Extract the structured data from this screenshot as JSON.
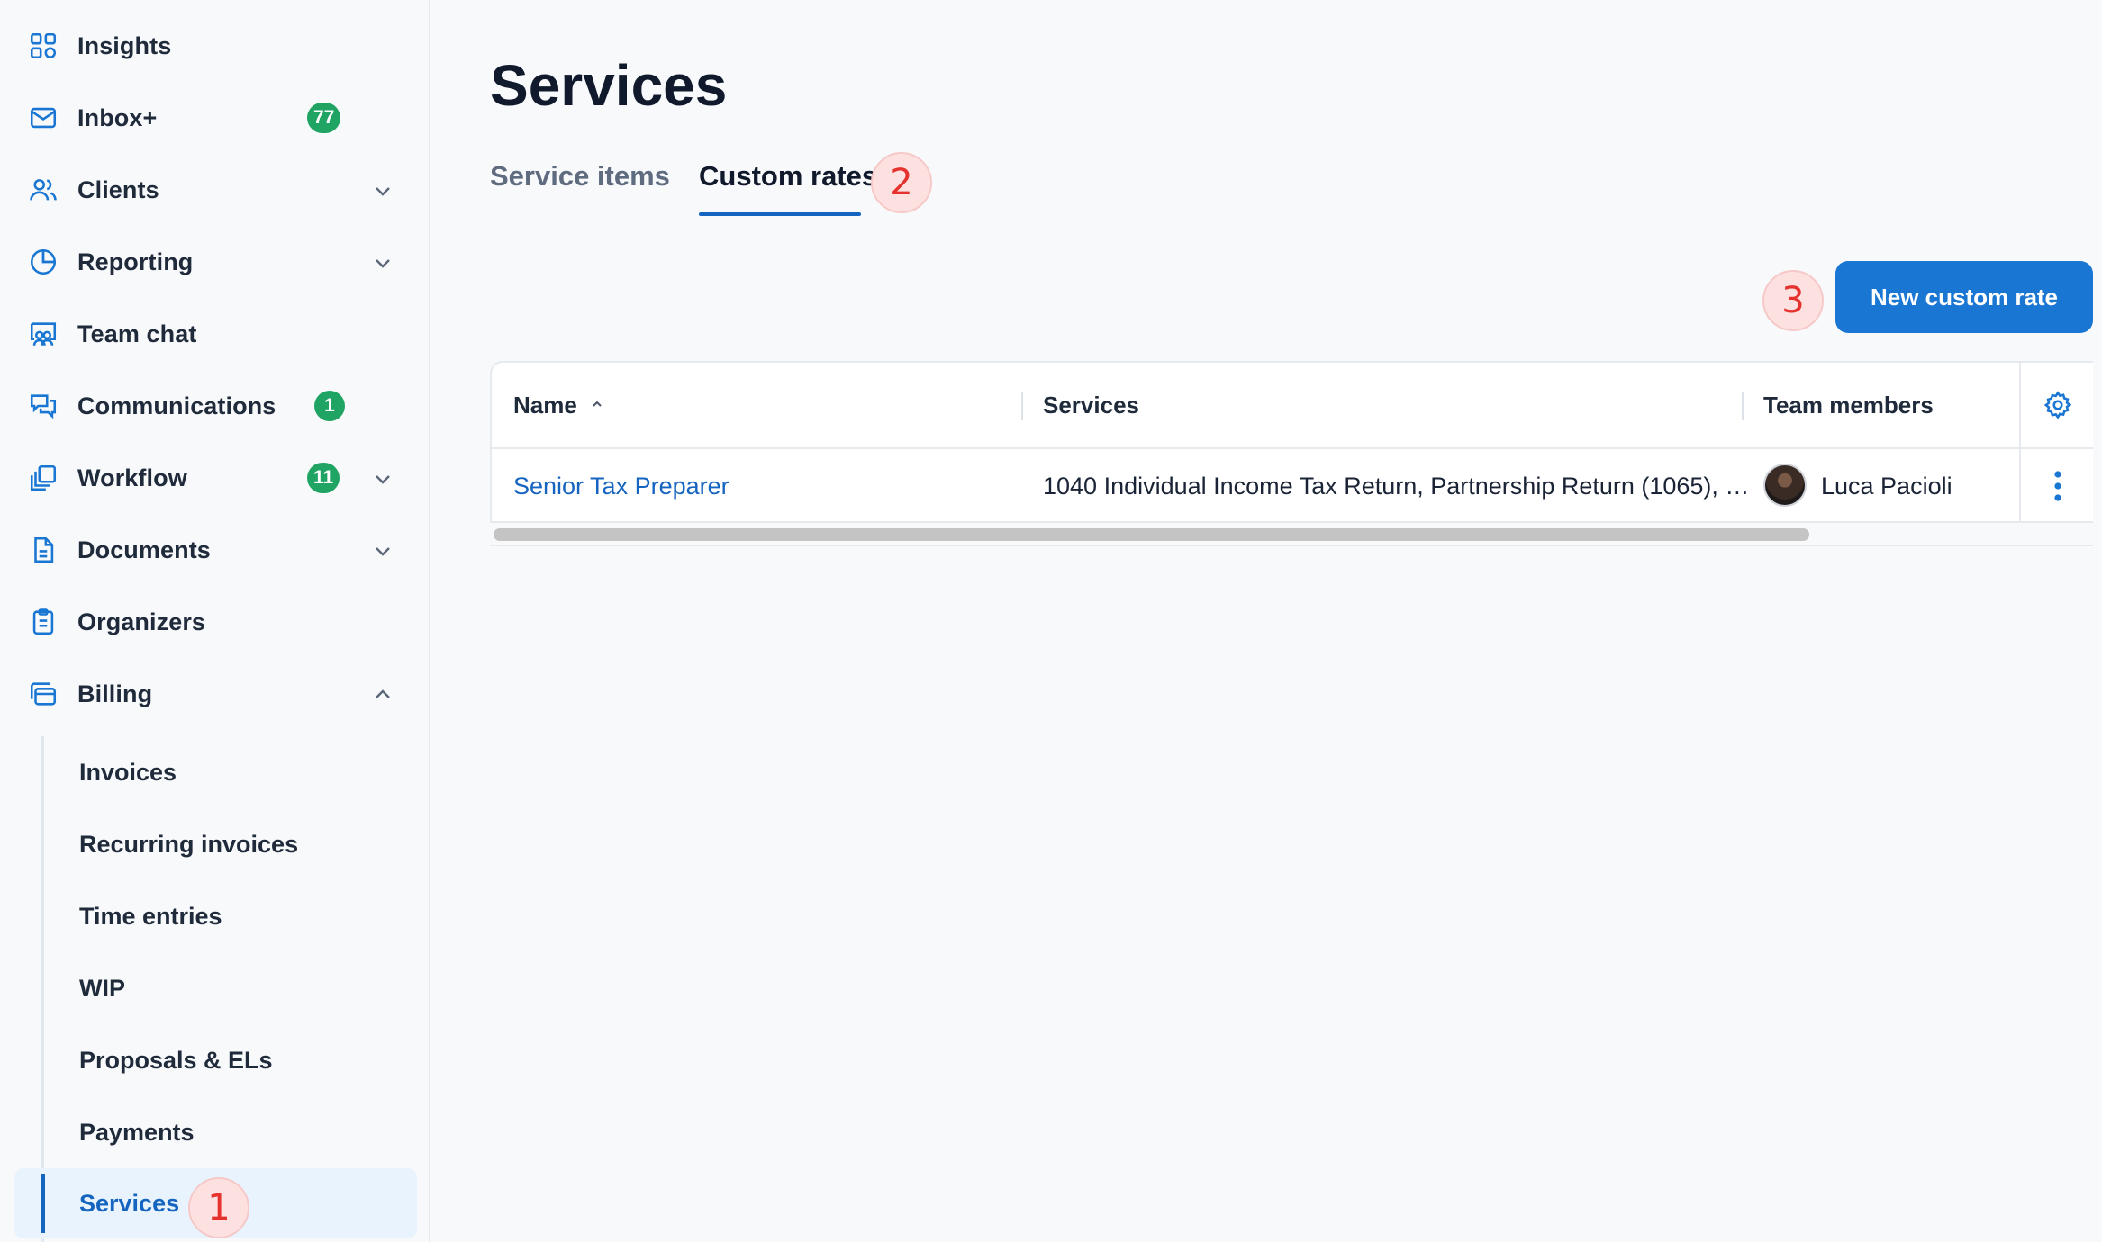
{
  "sidebar": {
    "items": [
      {
        "label": "Insights",
        "icon": "grid-icon"
      },
      {
        "label": "Inbox+",
        "icon": "mail-icon",
        "badge": "77"
      },
      {
        "label": "Clients",
        "icon": "users-icon"
      },
      {
        "label": "Reporting",
        "icon": "pie-chart-icon"
      },
      {
        "label": "Team chat",
        "icon": "team-chat-icon"
      },
      {
        "label": "Communications",
        "icon": "chat-bubbles-icon",
        "badge": "1"
      },
      {
        "label": "Workflow",
        "icon": "workflow-icon",
        "badge": "11"
      },
      {
        "label": "Documents",
        "icon": "document-icon"
      },
      {
        "label": "Organizers",
        "icon": "clipboard-icon"
      },
      {
        "label": "Billing",
        "icon": "billing-icon"
      }
    ],
    "billing_sub": [
      {
        "label": "Invoices"
      },
      {
        "label": "Recurring invoices"
      },
      {
        "label": "Time entries"
      },
      {
        "label": "WIP"
      },
      {
        "label": "Proposals & ELs"
      },
      {
        "label": "Payments"
      },
      {
        "label": "Services",
        "active": true
      }
    ]
  },
  "markers": {
    "one": "1",
    "two": "2",
    "three": "3"
  },
  "main": {
    "title": "Services",
    "tabs": [
      {
        "label": "Service items",
        "active": false
      },
      {
        "label": "Custom rates",
        "active": true
      }
    ],
    "new_button_label": "New custom rate",
    "table": {
      "columns": [
        "Name",
        "Services",
        "Team members"
      ],
      "rows": [
        {
          "name": "Senior Tax Preparer",
          "services": "1040 Individual Income Tax Return, Partnership Return (1065), …",
          "team_member": "Luca Pacioli"
        }
      ]
    }
  },
  "colors": {
    "accent": "#1976d2",
    "badge": "#1fa463",
    "marker": "#e5322f",
    "active_bg": "#e9f3fd"
  }
}
